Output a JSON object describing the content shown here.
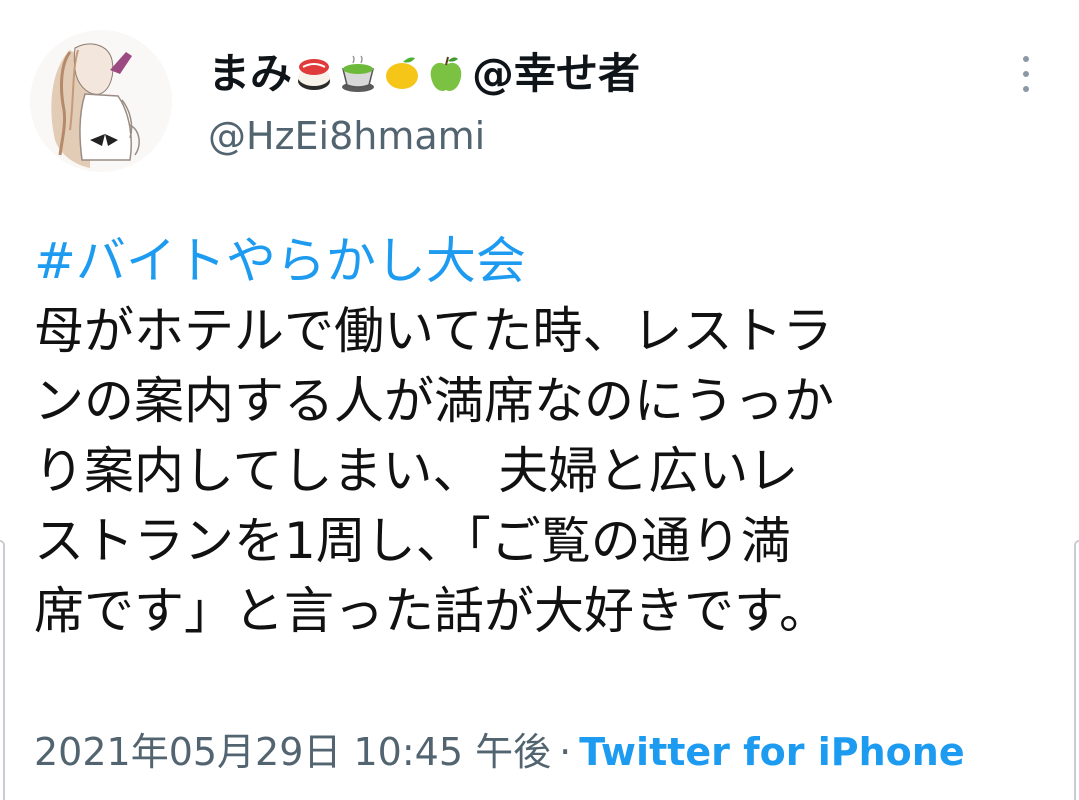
{
  "author": {
    "display_name": "まみ",
    "name_suffix": "@幸せ者",
    "name_emojis": [
      "sushi-icon",
      "green-tea-icon",
      "lemon-icon",
      "green-apple-icon"
    ],
    "handle": "@HzEi8hmami",
    "avatar": "girl-sketch-avatar"
  },
  "tweet": {
    "hashtag": "#バイトやらかし大会",
    "lines": [
      "母がホテルで働いてた時、レストラ",
      "ンの案内する人が満席なのにうっか",
      "り案内してしまい、 夫婦と広いレ",
      "ストランを1周し、「ご覧の通り満",
      "席です」と言った話が大好きです。"
    ]
  },
  "meta": {
    "timestamp": "2021年05月29日 10:45 午後",
    "separator": "·",
    "source": "Twitter for iPhone"
  },
  "colors": {
    "link": "#1d9bf0",
    "secondary_text": "#536471",
    "primary_text": "#0f1419"
  },
  "icons": {
    "more": "more-vertical-icon"
  }
}
